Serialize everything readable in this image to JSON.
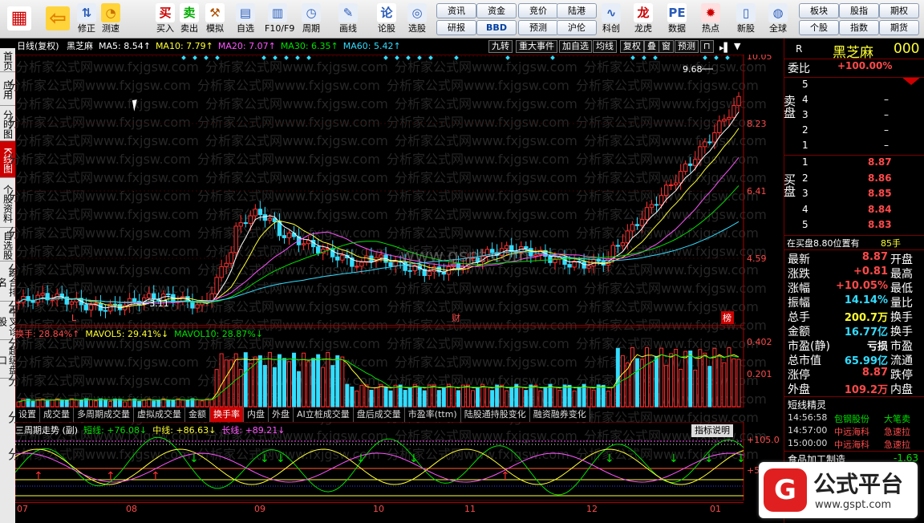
{
  "toolbar": {
    "buttons": [
      {
        "label": "",
        "icon": "multi-window-icon"
      },
      {
        "label": "",
        "icon": "back-arrow-icon"
      },
      {
        "label": "修正",
        "icon": "up-down-arrow-icon"
      },
      {
        "label": "测速",
        "icon": "speed-icon"
      },
      {
        "label": "买入",
        "icon": "buy-icon",
        "glyph": "买"
      },
      {
        "label": "卖出",
        "icon": "sell-icon",
        "glyph": "卖"
      },
      {
        "label": "模拟",
        "icon": "hammer-icon"
      },
      {
        "label": "自选",
        "icon": "watchlist-icon"
      },
      {
        "label": "F10/F9",
        "icon": "f10-icon"
      },
      {
        "label": "周期",
        "icon": "clock-icon"
      },
      {
        "label": "画线",
        "icon": "pencil-icon"
      },
      {
        "label": "论股",
        "icon": "discuss-icon",
        "glyph": "论"
      },
      {
        "label": "选股",
        "icon": "magnifier-icon"
      },
      {
        "label": "龙虎",
        "icon": "dragon-icon"
      },
      {
        "label": "科创",
        "icon": "chart-icon"
      },
      {
        "label": "数据",
        "icon": "pe-icon",
        "glyph": "PE"
      },
      {
        "label": "热点",
        "icon": "hot-icon"
      },
      {
        "label": "新股",
        "icon": "ipo-icon"
      },
      {
        "label": "全球",
        "icon": "globe-icon"
      }
    ],
    "pills": [
      [
        "资讯",
        "研报"
      ],
      [
        "资金",
        "BBD"
      ],
      [
        "竞价",
        "预测"
      ],
      [
        "陆港",
        "沪伦"
      ],
      [
        "板块",
        "个股"
      ],
      [
        "股指",
        "指数"
      ],
      [
        "期权",
        "期货"
      ]
    ]
  },
  "left_tabs": [
    "首页",
    "应用",
    "分时图",
    "K线图",
    "个股资料",
    "自选股",
    "综合排名",
    "牛叉诊股",
    "超级盘口"
  ],
  "chart_header": {
    "mode": "日线(复权)",
    "stock": "黑芝麻",
    "ma": [
      {
        "label": "MA5: 8.54↑",
        "color": "#ffffff"
      },
      {
        "label": "MA10: 7.79↑",
        "color": "#ffff33"
      },
      {
        "label": "MA20: 7.07↑",
        "color": "#ff55ff"
      },
      {
        "label": "MA30: 6.35↑",
        "color": "#00e000"
      },
      {
        "label": "MA60: 5.42↑",
        "color": "#33ddff"
      }
    ],
    "buttons": [
      "九转",
      "重大事件",
      "加自选",
      "均线",
      "复权",
      "叠",
      "窗",
      "预测"
    ]
  },
  "watermark": "分析家公式网www.fxjgsw.com",
  "watermark2": "www.gspt.com",
  "price_axis": [
    "10.05",
    "8.23",
    "6.41",
    "4.59"
  ],
  "price_labels": {
    "high": "9.68",
    "low": "3.11",
    "L": "L",
    "cai": "财",
    "bang": "榜"
  },
  "vol_header": {
    "turnover": "换手: 28.84%↑",
    "mavol5": "MAVOL5: 29.41%↓",
    "mavol10": "MAVOL10: 28.87%↓"
  },
  "vol_axis": [
    "0.402",
    "0.201"
  ],
  "tabs": [
    "设置",
    "成交量",
    "多周期成交量",
    "虚拟成交量",
    "金额",
    "换手率",
    "内盘",
    "外盘",
    "AI立桩成交量",
    "盘后成交量",
    "市盈率(ttm)",
    "陆股通持股变化",
    "融资融券变化"
  ],
  "active_tab": "换手率",
  "ind_header": {
    "title": "三周期走势 (副)",
    "short": "短线: +76.08↓",
    "mid": "中线: +86.63↓",
    "long": "长线: +89.21↓",
    "explain": "指标说明"
  },
  "ind_axis": [
    "+105.0",
    "+50.00"
  ],
  "x_axis": [
    "07",
    "08",
    "09",
    "10",
    "11",
    "12",
    "01"
  ],
  "right": {
    "name": "黑芝麻",
    "code": "000",
    "webi_label": "委比",
    "webi_value": "+100.00%",
    "flag": "R",
    "sell_label": "卖盘",
    "buy_label": "买盘",
    "sells": [
      {
        "n": "5",
        "p": ""
      },
      {
        "n": "4",
        "p": "–"
      },
      {
        "n": "3",
        "p": "–"
      },
      {
        "n": "2",
        "p": "–"
      },
      {
        "n": "1",
        "p": "–"
      }
    ],
    "buys": [
      {
        "n": "1",
        "p": "8.87"
      },
      {
        "n": "2",
        "p": "8.86"
      },
      {
        "n": "3",
        "p": "8.85"
      },
      {
        "n": "4",
        "p": "8.84"
      },
      {
        "n": "5",
        "p": "8.83"
      }
    ],
    "status": "在买盘8.80位置有",
    "status_val": "85手",
    "stats": [
      {
        "l": "最新",
        "v": "8.87",
        "r": "开盘",
        "c": "#ff4a4a"
      },
      {
        "l": "涨跌",
        "v": "+0.81",
        "r": "最高",
        "c": "#ff4a4a"
      },
      {
        "l": "涨幅",
        "v": "+10.05%",
        "r": "最低",
        "c": "#ff4a4a"
      },
      {
        "l": "振幅",
        "v": "14.14%",
        "r": "量比",
        "c": "#33ddff"
      },
      {
        "l": "总手",
        "v": "200.7万",
        "r": "换手",
        "c": "#ffff33"
      },
      {
        "l": "金额",
        "v": "16.77亿",
        "r": "换手",
        "c": "#33ddff"
      },
      {
        "l": "市盈(静)",
        "v": "亏损",
        "r": "市盈",
        "c": "#ffffff"
      },
      {
        "l": "总市值",
        "v": "65.99亿",
        "r": "流通",
        "c": "#33ddff"
      },
      {
        "l": "涨停",
        "v": "8.87",
        "r": "跌停",
        "c": "#ff4a4a"
      },
      {
        "l": "外盘",
        "v": "109.2万",
        "r": "内盘",
        "c": "#ff4a4a"
      }
    ],
    "short_title": "短线精灵",
    "short_items": [
      {
        "t": "14:56:58",
        "s": "包钢股份",
        "e": "大笔卖"
      },
      {
        "t": "14:57:00",
        "s": "中远海科",
        "e": "急速拉"
      },
      {
        "t": "15:00:00",
        "s": "中远海科",
        "e": "急速拉"
      }
    ],
    "sector": "食品加工制造",
    "sector_val": "-1.63"
  },
  "logo": {
    "text": "公式平台",
    "url": "www.gspt.com"
  }
}
